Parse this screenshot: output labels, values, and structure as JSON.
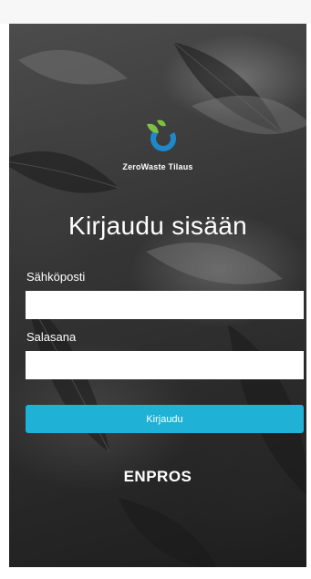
{
  "app": {
    "name": "ZeroWaste Tilaus"
  },
  "logo": {
    "icon": "zerowaste-leaf-ring-logo",
    "colors": {
      "green": "#7cc242",
      "blue": "#1e88c8"
    }
  },
  "login": {
    "heading": "Kirjaudu sisään",
    "email_label": "Sähköposti",
    "email_value": "",
    "password_label": "Salasana",
    "password_value": "",
    "submit_label": "Kirjaudu"
  },
  "footer": {
    "brand": "ENPROS"
  },
  "colors": {
    "accent": "#20b1d6",
    "input_bg": "#ffffff",
    "text": "#ffffff"
  }
}
